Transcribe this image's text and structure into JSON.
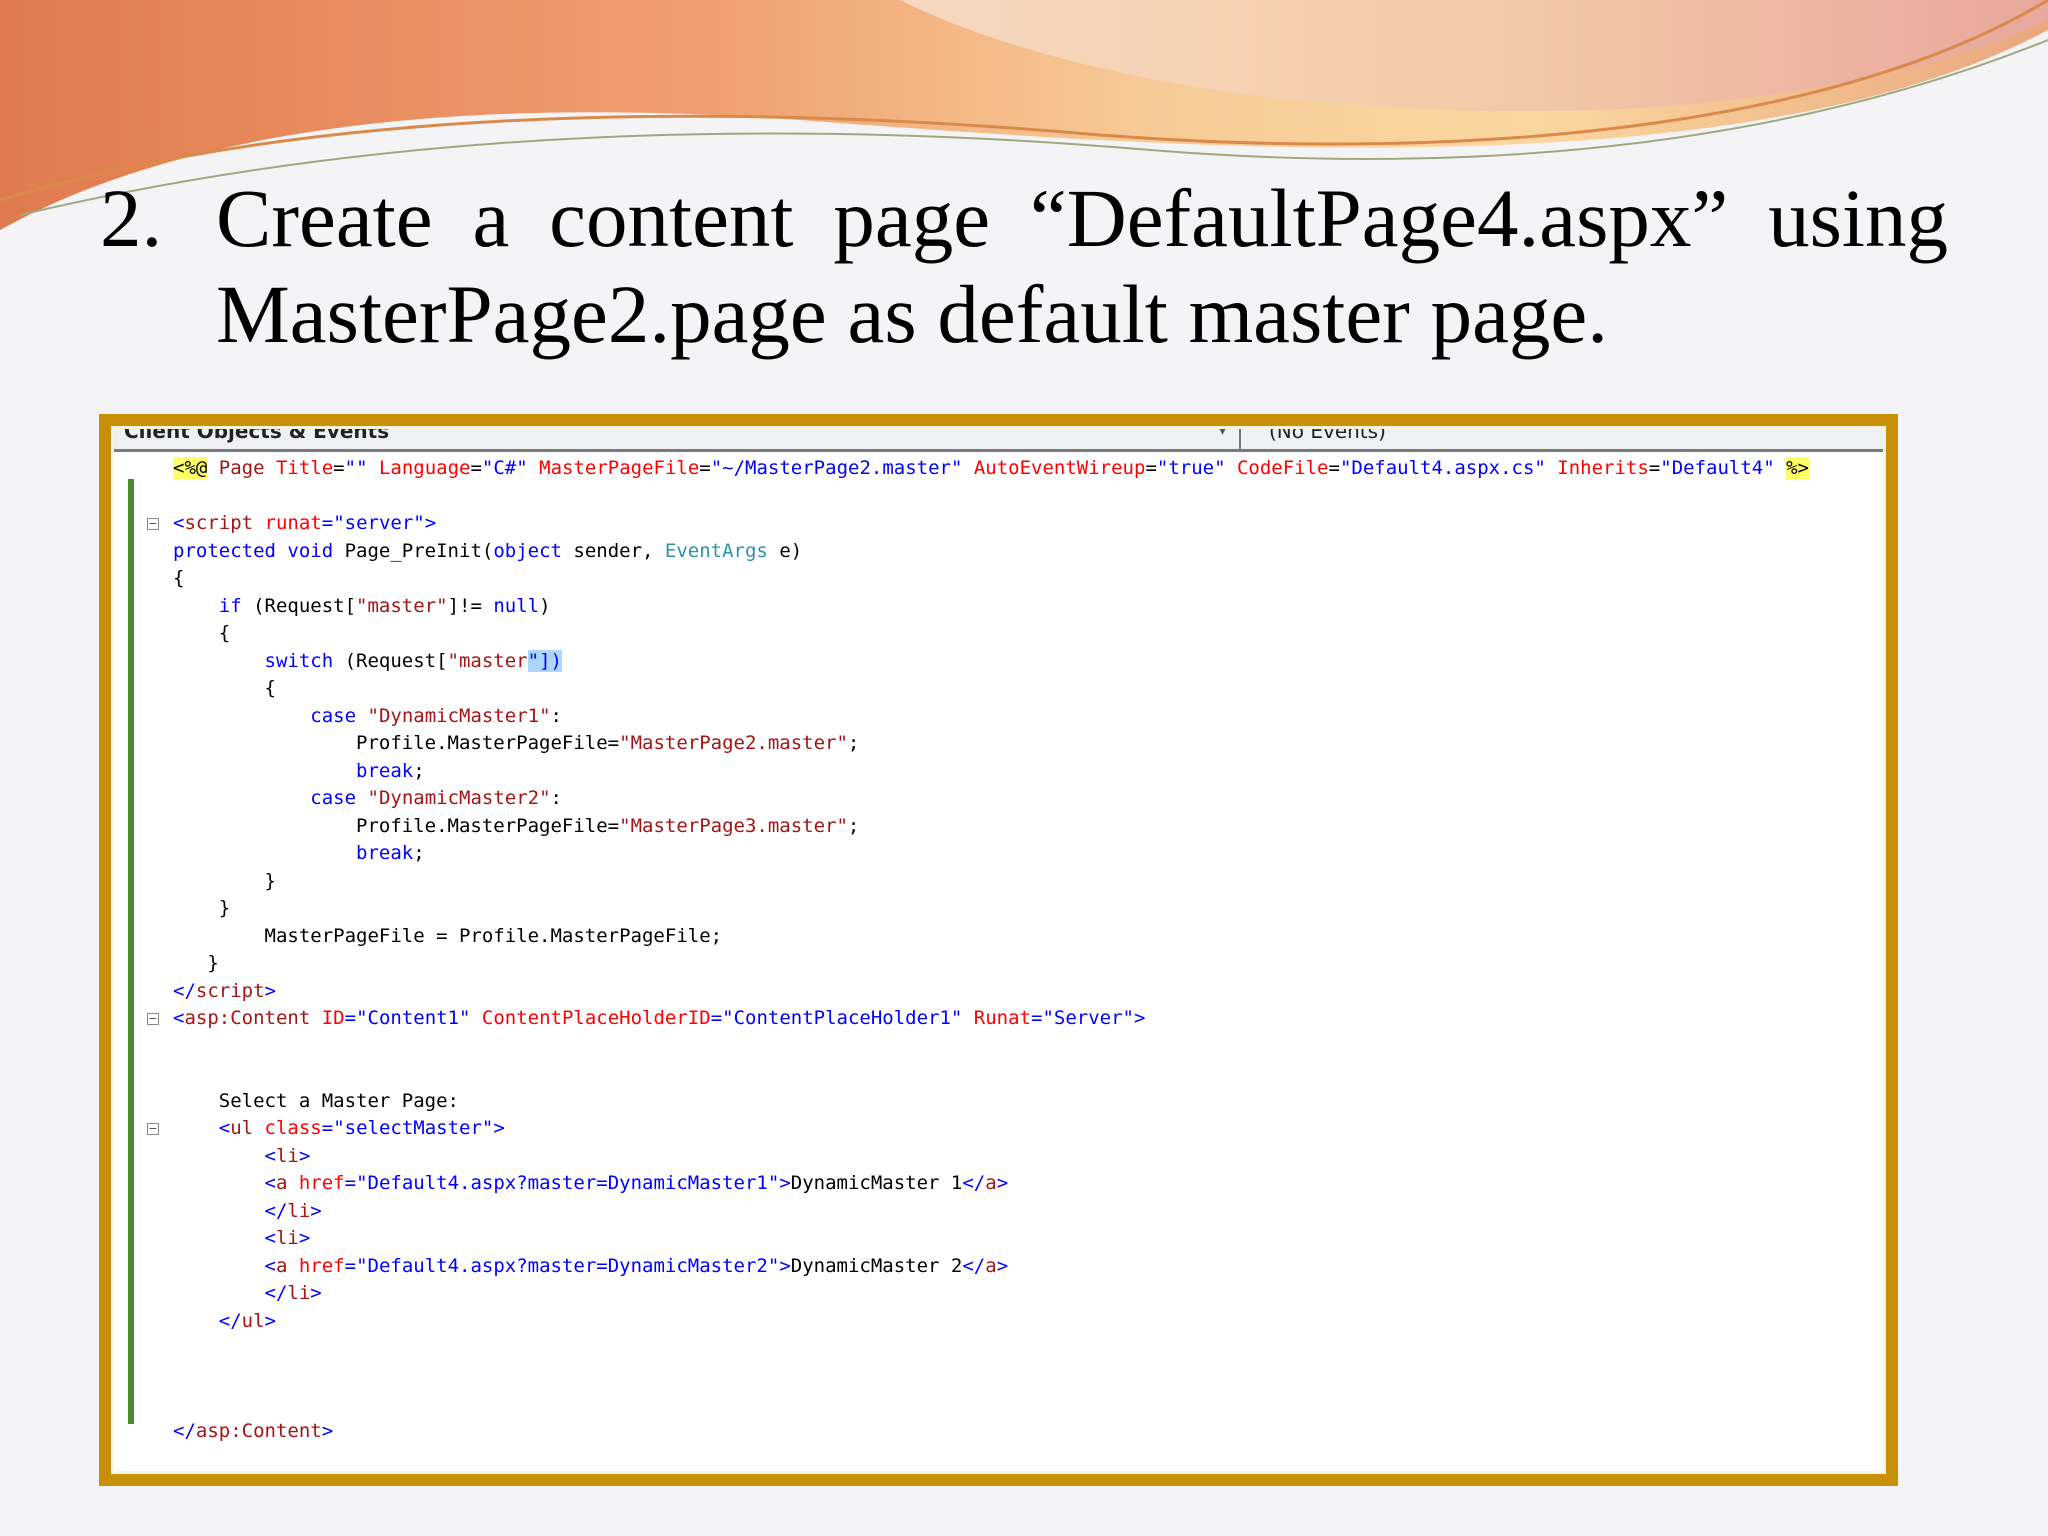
{
  "slide": {
    "number": "2.",
    "heading_line1_words": [
      "Create",
      "a",
      "content",
      "page",
      "“DefaultPage4.aspx”",
      "using"
    ],
    "heading_line2": "MasterPage2.page as default master page."
  },
  "editor": {
    "objects_dropdown": "Client Objects & Events",
    "events_dropdown": "(No Events)",
    "colors": {
      "tag": "#a31515",
      "attr": "#ff0000",
      "value": "#0000ff",
      "keyword": "#0000ff",
      "type": "#2b91af",
      "frame": "#c79008",
      "gutter": "#4f8a2e"
    },
    "code_lines": [
      {
        "fold": false,
        "tokens": [
          [
            "<%@",
            "hl-dark"
          ],
          [
            " Page ",
            "tag"
          ],
          [
            "Title",
            "attr"
          ],
          [
            "=",
            "plain"
          ],
          [
            "\"\"",
            "value"
          ],
          [
            " Language",
            "attr"
          ],
          [
            "=",
            "plain"
          ],
          [
            "\"C#\"",
            "value"
          ],
          [
            " MasterPageFile",
            "attr"
          ],
          [
            "=",
            "plain"
          ],
          [
            "\"~/MasterPage2.master\"",
            "value"
          ],
          [
            " AutoEventWireup",
            "attr"
          ],
          [
            "=",
            "plain"
          ],
          [
            "\"true\"",
            "value"
          ],
          [
            " CodeFile",
            "attr"
          ],
          [
            "=",
            "plain"
          ],
          [
            "\"Default4.aspx.cs\"",
            "value"
          ],
          [
            " Inherits",
            "attr"
          ],
          [
            "=",
            "plain"
          ],
          [
            "\"Default4\"",
            "value"
          ],
          [
            " ",
            "plain"
          ],
          [
            "%>",
            "hl-dark"
          ]
        ]
      },
      {
        "fold": false,
        "tokens": []
      },
      {
        "fold": true,
        "tokens": [
          [
            "<",
            "value"
          ],
          [
            "script",
            "tag"
          ],
          [
            " runat",
            "attr"
          ],
          [
            "=",
            "value"
          ],
          [
            "\"server\"",
            "value"
          ],
          [
            ">",
            "value"
          ]
        ]
      },
      {
        "fold": false,
        "tokens": [
          [
            "protected",
            "keyword"
          ],
          [
            " ",
            "plain"
          ],
          [
            "void",
            "keyword"
          ],
          [
            " Page_PreInit(",
            "plain"
          ],
          [
            "object",
            "keyword"
          ],
          [
            " sender, ",
            "plain"
          ],
          [
            "EventArgs",
            "type"
          ],
          [
            " e)",
            "plain"
          ]
        ]
      },
      {
        "fold": false,
        "tokens": [
          [
            "{",
            "plain"
          ]
        ]
      },
      {
        "fold": false,
        "tokens": [
          [
            "    ",
            "plain"
          ],
          [
            "if",
            "keyword"
          ],
          [
            " (Request[",
            "plain"
          ],
          [
            "\"master\"",
            "tag"
          ],
          [
            "]!= ",
            "plain"
          ],
          [
            "null",
            "keyword"
          ],
          [
            ")",
            "plain"
          ]
        ]
      },
      {
        "fold": false,
        "tokens": [
          [
            "    {",
            "plain"
          ]
        ]
      },
      {
        "fold": false,
        "tokens": [
          [
            "        ",
            "plain"
          ],
          [
            "switch",
            "keyword"
          ],
          [
            " (Request[",
            "plain"
          ],
          [
            "\"master",
            "tag"
          ],
          [
            "\"])",
            "sel"
          ]
        ]
      },
      {
        "fold": false,
        "tokens": [
          [
            "        {",
            "plain"
          ]
        ]
      },
      {
        "fold": false,
        "tokens": [
          [
            "            ",
            "plain"
          ],
          [
            "case",
            "keyword"
          ],
          [
            " ",
            "plain"
          ],
          [
            "\"DynamicMaster1\"",
            "tag"
          ],
          [
            ":",
            "plain"
          ]
        ]
      },
      {
        "fold": false,
        "tokens": [
          [
            "                Profile.MasterPageFile=",
            "plain"
          ],
          [
            "\"MasterPage2.master\"",
            "tag"
          ],
          [
            ";",
            "plain"
          ]
        ]
      },
      {
        "fold": false,
        "tokens": [
          [
            "                ",
            "plain"
          ],
          [
            "break",
            "keyword"
          ],
          [
            ";",
            "plain"
          ]
        ]
      },
      {
        "fold": false,
        "tokens": [
          [
            "            ",
            "plain"
          ],
          [
            "case",
            "keyword"
          ],
          [
            " ",
            "plain"
          ],
          [
            "\"DynamicMaster2\"",
            "tag"
          ],
          [
            ":",
            "plain"
          ]
        ]
      },
      {
        "fold": false,
        "tokens": [
          [
            "                Profile.MasterPageFile=",
            "plain"
          ],
          [
            "\"MasterPage3.master\"",
            "tag"
          ],
          [
            ";",
            "plain"
          ]
        ]
      },
      {
        "fold": false,
        "tokens": [
          [
            "                ",
            "plain"
          ],
          [
            "break",
            "keyword"
          ],
          [
            ";",
            "plain"
          ]
        ]
      },
      {
        "fold": false,
        "tokens": [
          [
            "        }",
            "plain"
          ]
        ]
      },
      {
        "fold": false,
        "tokens": [
          [
            "    }",
            "plain"
          ]
        ]
      },
      {
        "fold": false,
        "tokens": [
          [
            "        MasterPageFile = Profile.MasterPageFile;",
            "plain"
          ]
        ]
      },
      {
        "fold": false,
        "tokens": [
          [
            "   }",
            "plain"
          ]
        ]
      },
      {
        "fold": false,
        "tokens": [
          [
            "</",
            "value"
          ],
          [
            "script",
            "tag"
          ],
          [
            ">",
            "value"
          ]
        ]
      },
      {
        "fold": true,
        "tokens": [
          [
            "<",
            "value"
          ],
          [
            "asp:Content",
            "tag"
          ],
          [
            " ID",
            "attr"
          ],
          [
            "=",
            "value"
          ],
          [
            "\"Content1\"",
            "value"
          ],
          [
            " ContentPlaceHolderID",
            "attr"
          ],
          [
            "=",
            "value"
          ],
          [
            "\"ContentPlaceHolder1\"",
            "value"
          ],
          [
            " Runat",
            "attr"
          ],
          [
            "=",
            "value"
          ],
          [
            "\"Server\"",
            "value"
          ],
          [
            ">",
            "value"
          ]
        ]
      },
      {
        "fold": false,
        "tokens": []
      },
      {
        "fold": false,
        "tokens": []
      },
      {
        "fold": false,
        "tokens": [
          [
            "    Select a Master Page:",
            "plain"
          ]
        ]
      },
      {
        "fold": true,
        "tokens": [
          [
            "    <",
            "value"
          ],
          [
            "ul",
            "tag"
          ],
          [
            " class",
            "attr"
          ],
          [
            "=",
            "value"
          ],
          [
            "\"selectMaster\"",
            "value"
          ],
          [
            ">",
            "value"
          ]
        ]
      },
      {
        "fold": false,
        "tokens": [
          [
            "        <",
            "value"
          ],
          [
            "li",
            "tag"
          ],
          [
            ">",
            "value"
          ]
        ]
      },
      {
        "fold": false,
        "tokens": [
          [
            "        <",
            "value"
          ],
          [
            "a",
            "tag"
          ],
          [
            " href",
            "attr"
          ],
          [
            "=",
            "value"
          ],
          [
            "\"Default4.aspx?master=DynamicMaster1\"",
            "value"
          ],
          [
            ">",
            "value"
          ],
          [
            "DynamicMaster 1",
            "plain"
          ],
          [
            "</",
            "value"
          ],
          [
            "a",
            "tag"
          ],
          [
            ">",
            "value"
          ]
        ]
      },
      {
        "fold": false,
        "tokens": [
          [
            "        </",
            "value"
          ],
          [
            "li",
            "tag"
          ],
          [
            ">",
            "value"
          ]
        ]
      },
      {
        "fold": false,
        "tokens": [
          [
            "        <",
            "value"
          ],
          [
            "li",
            "tag"
          ],
          [
            ">",
            "value"
          ]
        ]
      },
      {
        "fold": false,
        "tokens": [
          [
            "        <",
            "value"
          ],
          [
            "a",
            "tag"
          ],
          [
            " href",
            "attr"
          ],
          [
            "=",
            "value"
          ],
          [
            "\"Default4.aspx?master=DynamicMaster2\"",
            "value"
          ],
          [
            ">",
            "value"
          ],
          [
            "DynamicMaster 2",
            "plain"
          ],
          [
            "</",
            "value"
          ],
          [
            "a",
            "tag"
          ],
          [
            ">",
            "value"
          ]
        ]
      },
      {
        "fold": false,
        "tokens": [
          [
            "        </",
            "value"
          ],
          [
            "li",
            "tag"
          ],
          [
            ">",
            "value"
          ]
        ]
      },
      {
        "fold": false,
        "tokens": [
          [
            "    </",
            "value"
          ],
          [
            "ul",
            "tag"
          ],
          [
            ">",
            "value"
          ]
        ]
      },
      {
        "fold": false,
        "tokens": []
      },
      {
        "fold": false,
        "tokens": []
      },
      {
        "fold": false,
        "tokens": []
      },
      {
        "fold": false,
        "tokens": [
          [
            "</",
            "value"
          ],
          [
            "asp:Content",
            "tag"
          ],
          [
            ">",
            "value"
          ]
        ]
      }
    ]
  }
}
